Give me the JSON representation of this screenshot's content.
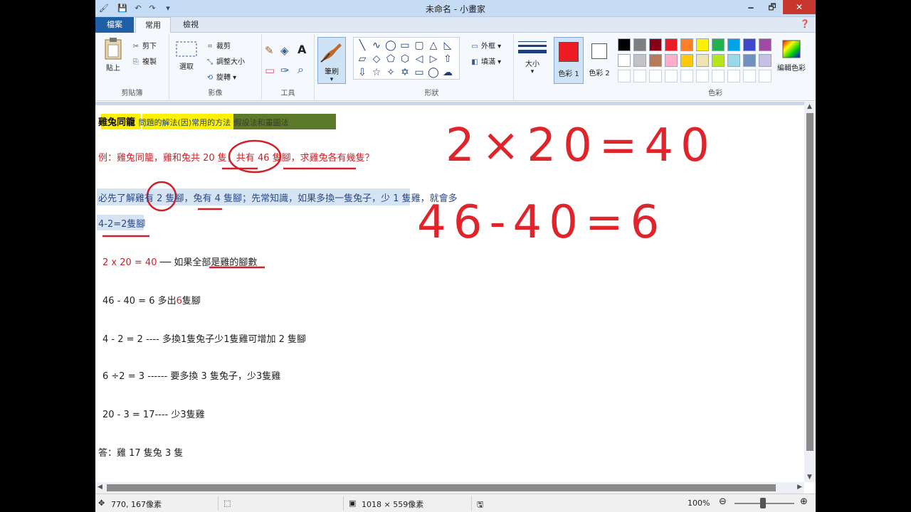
{
  "window": {
    "title": "未命名 - 小畫家",
    "min": "🗕",
    "max": "🗗",
    "close": "✕"
  },
  "quick_access": [
    "🖌",
    "💾",
    "↶",
    "↷",
    "▾"
  ],
  "tabs": {
    "file": "檔案",
    "home": "常用",
    "view": "檢視"
  },
  "help": "❓",
  "ribbon": {
    "clipboard": {
      "label": "剪貼簿",
      "paste": "貼上",
      "cut": "剪下",
      "copy": "複製"
    },
    "image": {
      "label": "影像",
      "select": "選取",
      "crop": "裁剪",
      "resize": "調整大小",
      "rotate": "旋轉"
    },
    "tools": {
      "label": "工具",
      "pencil": "✎",
      "fill": "◈",
      "text": "A",
      "eraser": "▭",
      "picker": "✑",
      "magnifier": "⌕"
    },
    "brush": {
      "label": "筆刷"
    },
    "shapes": {
      "label": "形狀",
      "outline": "外框",
      "fill": "填滿",
      "icons": [
        "╲",
        "∿",
        "◯",
        "▭",
        "▢",
        "△",
        "◺",
        "▱",
        "◇",
        "⬠",
        "⬡",
        "◁",
        "▷",
        "⇧",
        "⇩",
        "☆",
        "✧",
        "✡",
        "▭",
        "◯",
        "☁"
      ]
    },
    "size": {
      "label": "大小"
    },
    "color1": {
      "label": "色彩 1"
    },
    "color2": {
      "label": "色彩 2"
    },
    "colors": {
      "label": "色彩",
      "edit": "編輯色彩",
      "row1": [
        "#000000",
        "#7f7f7f",
        "#880015",
        "#ed1c24",
        "#ff7f27",
        "#fff200",
        "#22b14c",
        "#00a2e8",
        "#3f48cc",
        "#a349a4"
      ],
      "row2": [
        "#ffffff",
        "#c3c3c3",
        "#b97a57",
        "#ffaec9",
        "#ffc90e",
        "#efe4b0",
        "#b5e61d",
        "#99d9ea",
        "#7092be",
        "#c8bfe7"
      ]
    }
  },
  "canvas": {
    "title_highlight": "雞兔同籠",
    "title_sub": "問題的解法(因)常用的方法",
    "title_rest": "假設法和畫圖法",
    "example": "例：雞兔同籠，雞和兔共 20 隻，共有 46 隻腳，求雞兔各有幾隻？",
    "note1": "必先了解雞有 2 隻腳，兔有 4 隻腳；先常知識，如果多換一隻兔子，少 1 隻雞，就會多",
    "note2": "4-2=2隻腳",
    "step1_expr": "2 x 20 = 40",
    "step1_text": " ── 如果全部是雞的腳數",
    "step2_expr": "46 - 40 = 6",
    "step2_pre": "  多出",
    "step2_num": "6",
    "step2_post": "隻腳",
    "step3": "4 - 2 = 2 ---- 多換1隻兔子少1隻雞可增加 2 隻腳",
    "step4": "6 ÷2 = 3 ------ 要多換 3 隻兔子，少3隻雞",
    "step5": "20 - 3 = 17---- 少3隻雞",
    "answer": "答：雞 17 隻兔 3 隻",
    "hand1": "2×20=40",
    "hand2": "46-40=6"
  },
  "status": {
    "coords": "770, 167像素",
    "canvas_size": "1018 × 559像素",
    "zoom": "100%",
    "zoom_level": 100
  }
}
